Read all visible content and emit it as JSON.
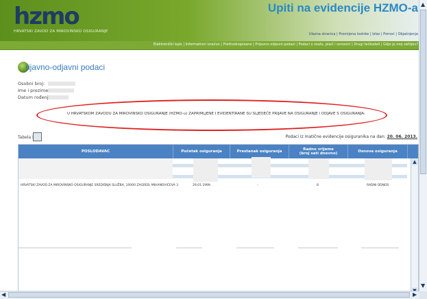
{
  "header": {
    "logo": "hzmo",
    "institution": "HRVATSKI ZAVOD ZA MIROVINSKO OSIGURANJE",
    "app_title": "Upiti na evidencije HZMO-a",
    "toplinks": "Ulazna stranica | Promijena lozinke | Izlaz | Pomoć | Objašnjenja",
    "navlinks": "Elektronički ispis | Informativni izračun | Prethodnopisane | Prijavno-odjavni podaci | Podaci o stažu, plaći i osnovici | Drugi tečkodeli | Gdje je moj zahtjev?"
  },
  "section": {
    "title": "rijavno-odjavni podaci"
  },
  "fields": [
    {
      "label": "Osobni broj:"
    },
    {
      "label": "Ime i prezime:"
    },
    {
      "label": "Datum rođenja:"
    }
  ],
  "notice": "U HRVATSKOM ZAVODU ZA MIROVINSKO OSIGURANJE (HZMO-u) ZAPRIMLJENE I EVIDENTIRANE SU SLJEDEĆE PRIJAVE NA OSIGURANJE I ODJAVE S OSIGURANJA:",
  "table": {
    "tabela_label": "Tabela I",
    "podaci_prefix": "Podaci iz matične evidencije osiguranika na dan:",
    "podaci_date": "20. 06. 2013.",
    "columns": {
      "poslodavac": "POSLODAVAC",
      "pocetak": "Početak osiguranja",
      "prestanak": "Prestanak osiguranja",
      "radno_vrijeme_1": "Radno vrijeme",
      "radno_vrijeme_2": "(broj sati dnevno)",
      "osnova": "Osnova osiguranja"
    },
    "row": {
      "poslodavac": "HRVATSKI ZAVOD ZA MIROVINSKO OSIGURANJE SREDIŠNJA SLUŽBA, 10000 ZAGREB, MIHANOVIĆEVA 3",
      "pocetak": "29.01.1999.",
      "prestanak": "-",
      "radno_vrijeme": "8",
      "osnova": "RADNI ODNOS"
    }
  },
  "icons": {
    "scroll_up": "scroll-up-icon",
    "scroll_down": "scroll-down-icon",
    "scroll_left": "scroll-left-icon",
    "scroll_right": "scroll-right-icon",
    "print": "print-icon"
  },
  "colors": {
    "brand_green": "#7daa35",
    "title_blue": "#2c89c4",
    "table_header": "#4b82c4",
    "notice_ellipse": "#e02020"
  }
}
